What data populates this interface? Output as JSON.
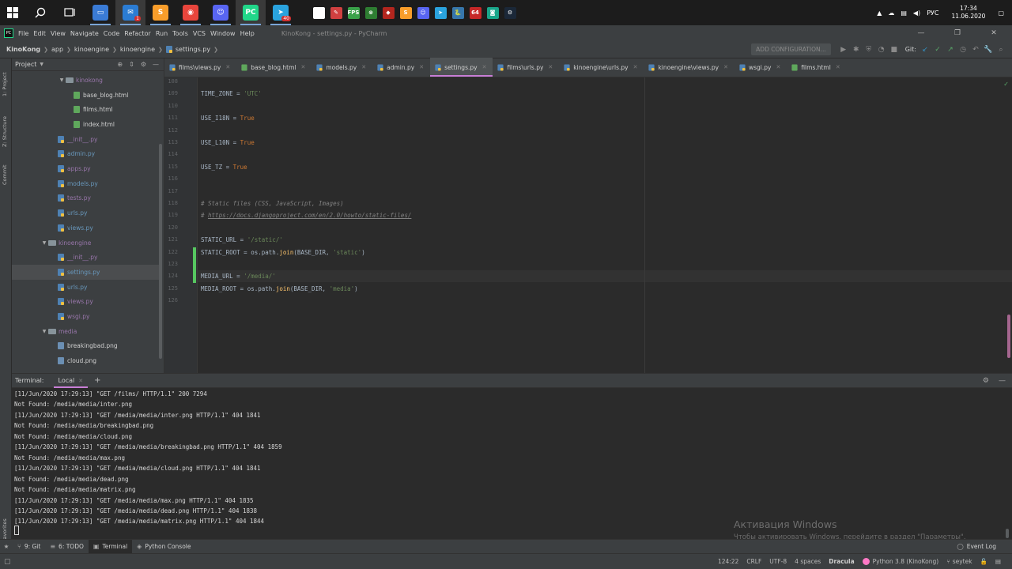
{
  "taskbar": {
    "apps": [
      {
        "name": "file-explorer",
        "color": "#3a7bd5",
        "glyph": "▭"
      },
      {
        "name": "mail",
        "color": "#2b7cd3",
        "glyph": "✉",
        "badge": "1",
        "active": true
      },
      {
        "name": "sublime-text",
        "color": "#f89d2a",
        "glyph": "S"
      },
      {
        "name": "chrome",
        "color": "#e8453c",
        "glyph": "◉"
      },
      {
        "name": "discord",
        "color": "#5865f2",
        "glyph": "☺"
      },
      {
        "name": "pycharm",
        "color": "#21d789",
        "glyph": "PC",
        "active": true
      },
      {
        "name": "telegram",
        "color": "#2aa3de",
        "glyph": "➤",
        "badge": "40"
      }
    ],
    "tray_apps": [
      {
        "name": "notepad",
        "color": "#ffffff",
        "glyph": ""
      },
      {
        "name": "pen-tool",
        "color": "#d04040",
        "glyph": "✎"
      },
      {
        "name": "fps-monitor",
        "color": "#3aa24a",
        "glyph": "FPS"
      },
      {
        "name": "xbox",
        "color": "#2e7d32",
        "glyph": "⊗"
      },
      {
        "name": "dota",
        "color": "#b3261e",
        "glyph": "◆"
      },
      {
        "name": "sublime-tray",
        "color": "#f89d2a",
        "glyph": "S"
      },
      {
        "name": "discord-tray",
        "color": "#5865f2",
        "glyph": "☺"
      },
      {
        "name": "telegram-tray",
        "color": "#2aa3de",
        "glyph": "➤"
      },
      {
        "name": "python-tray",
        "color": "#3776ab",
        "glyph": "🐍"
      },
      {
        "name": "aida64",
        "color": "#c62828",
        "glyph": "64"
      },
      {
        "name": "gamepad",
        "color": "#1aa68a",
        "glyph": "◙"
      },
      {
        "name": "steam",
        "color": "#1b2838",
        "glyph": "⚙"
      }
    ],
    "lang": "РУС",
    "time": "17:34",
    "date": "11.06.2020"
  },
  "menu": {
    "items": [
      "File",
      "Edit",
      "View",
      "Navigate",
      "Code",
      "Refactor",
      "Run",
      "Tools",
      "VCS",
      "Window",
      "Help"
    ],
    "title": "KinoKong - settings.py - PyCharm"
  },
  "breadcrumbs": [
    "KinoKong",
    "app",
    "kinoengine",
    "kinoengine",
    "settings.py"
  ],
  "nav": {
    "add_config": "ADD CONFIGURATION...",
    "git_label": "Git:"
  },
  "side_tabs": {
    "project": "1: Project",
    "structure": "Z: Structure",
    "commit": "Commit",
    "favorites": "2: Favorites"
  },
  "project_panel": {
    "title": "Project",
    "tree": [
      {
        "label": "kinokong",
        "type": "folder",
        "indent": 1,
        "open": true
      },
      {
        "label": "base_blog.html",
        "type": "html",
        "indent": 2
      },
      {
        "label": "films.html",
        "type": "html",
        "indent": 2
      },
      {
        "label": "index.html",
        "type": "html",
        "indent": 2
      },
      {
        "label": "__init__.py",
        "type": "py-dim",
        "indent": 0
      },
      {
        "label": "admin.py",
        "type": "py",
        "indent": 0
      },
      {
        "label": "apps.py",
        "type": "py-dim",
        "indent": 0
      },
      {
        "label": "models.py",
        "type": "py",
        "indent": 0
      },
      {
        "label": "tests.py",
        "type": "py-dim",
        "indent": 0
      },
      {
        "label": "urls.py",
        "type": "py",
        "indent": 0
      },
      {
        "label": "views.py",
        "type": "py",
        "indent": 0
      },
      {
        "label": "kinoengine",
        "type": "folder",
        "indent": -1,
        "open": true
      },
      {
        "label": "__init__.py",
        "type": "py-dim",
        "indent": 0
      },
      {
        "label": "settings.py",
        "type": "py",
        "indent": 0,
        "selected": true
      },
      {
        "label": "urls.py",
        "type": "py",
        "indent": 0
      },
      {
        "label": "views.py",
        "type": "py-dim",
        "indent": 0
      },
      {
        "label": "wsgi.py",
        "type": "py-dim",
        "indent": 0
      },
      {
        "label": "media",
        "type": "folder",
        "indent": -1,
        "open": true
      },
      {
        "label": "breakingbad.png",
        "type": "png",
        "indent": 0
      },
      {
        "label": "cloud.png",
        "type": "png",
        "indent": 0
      }
    ]
  },
  "editor": {
    "tabs": [
      {
        "label": "films\\views.py",
        "type": "py"
      },
      {
        "label": "base_blog.html",
        "type": "html"
      },
      {
        "label": "models.py",
        "type": "py"
      },
      {
        "label": "admin.py",
        "type": "py"
      },
      {
        "label": "settings.py",
        "type": "py",
        "active": true
      },
      {
        "label": "films\\urls.py",
        "type": "py"
      },
      {
        "label": "kinoengine\\urls.py",
        "type": "py"
      },
      {
        "label": "kinoengine\\views.py",
        "type": "py"
      },
      {
        "label": "wsgi.py",
        "type": "py"
      },
      {
        "label": "films.html",
        "type": "html"
      }
    ],
    "lines": [
      {
        "n": "108",
        "code": []
      },
      {
        "n": "109",
        "code": [
          [
            "plain",
            "TIME_ZONE = "
          ],
          [
            "str",
            "'UTC'"
          ]
        ]
      },
      {
        "n": "110",
        "code": []
      },
      {
        "n": "111",
        "code": [
          [
            "plain",
            "USE_I18N = "
          ],
          [
            "kw",
            "True"
          ]
        ]
      },
      {
        "n": "112",
        "code": []
      },
      {
        "n": "113",
        "code": [
          [
            "plain",
            "USE_L10N = "
          ],
          [
            "kw",
            "True"
          ]
        ]
      },
      {
        "n": "114",
        "code": []
      },
      {
        "n": "115",
        "code": [
          [
            "plain",
            "USE_TZ = "
          ],
          [
            "kw",
            "True"
          ]
        ]
      },
      {
        "n": "116",
        "code": []
      },
      {
        "n": "117",
        "code": []
      },
      {
        "n": "118",
        "code": [
          [
            "cm",
            "# Static files (CSS, JavaScript, Images)"
          ]
        ]
      },
      {
        "n": "119",
        "code": [
          [
            "cm",
            "# "
          ],
          [
            "link",
            "https://docs.djangoproject.com/en/2.0/howto/static-files/"
          ]
        ]
      },
      {
        "n": "120",
        "code": []
      },
      {
        "n": "121",
        "code": [
          [
            "plain",
            "STATIC_URL = "
          ],
          [
            "str",
            "'/static/'"
          ]
        ]
      },
      {
        "n": "122",
        "code": [
          [
            "plain",
            "STATIC_ROOT = os.path."
          ],
          [
            "fn",
            "join"
          ],
          [
            "plain",
            "(BASE_DIR, "
          ],
          [
            "str",
            "'static'"
          ],
          [
            "plain",
            ")"
          ]
        ],
        "changed": true
      },
      {
        "n": "123",
        "code": [],
        "changed": true
      },
      {
        "n": "124",
        "code": [
          [
            "plain",
            "MEDIA_URL = "
          ],
          [
            "str",
            "'/media/'"
          ]
        ],
        "changed": true,
        "current": true
      },
      {
        "n": "125",
        "code": [
          [
            "plain",
            "MEDIA_ROOT = os.path."
          ],
          [
            "fn",
            "join"
          ],
          [
            "plain",
            "(BASE_DIR, "
          ],
          [
            "str",
            "'media'"
          ],
          [
            "plain",
            ")"
          ]
        ]
      },
      {
        "n": "126",
        "code": []
      }
    ]
  },
  "terminal": {
    "title": "Terminal:",
    "tab": "Local",
    "lines": [
      "[11/Jun/2020 17:29:13] \"GET /films/ HTTP/1.1\" 200 7294",
      "Not Found: /media/media/inter.png",
      "[11/Jun/2020 17:29:13] \"GET /media/media/inter.png HTTP/1.1\" 404 1841",
      "Not Found: /media/media/breakingbad.png",
      "Not Found: /media/media/cloud.png",
      "[11/Jun/2020 17:29:13] \"GET /media/media/breakingbad.png HTTP/1.1\" 404 1859",
      "Not Found: /media/media/max.png",
      "[11/Jun/2020 17:29:13] \"GET /media/media/cloud.png HTTP/1.1\" 404 1841",
      "Not Found: /media/media/dead.png",
      "Not Found: /media/media/matrix.png",
      "[11/Jun/2020 17:29:13] \"GET /media/media/max.png HTTP/1.1\" 404 1835",
      "[11/Jun/2020 17:29:13] \"GET /media/media/dead.png HTTP/1.1\" 404 1838",
      "[11/Jun/2020 17:29:13] \"GET /media/media/matrix.png HTTP/1.1\" 404 1844"
    ]
  },
  "watermark": {
    "line1": "Активация Windows",
    "line2": "Чтобы активировать Windows, перейдите в раздел \"Параметры\"."
  },
  "bottom_tools": [
    {
      "label": "9: Git",
      "icon": "⑂"
    },
    {
      "label": "6: TODO",
      "icon": "≡"
    },
    {
      "label": "Terminal",
      "icon": "▣",
      "active": true
    },
    {
      "label": "Python Console",
      "icon": "◈"
    }
  ],
  "event_log": "Event Log",
  "status": {
    "position": "124:22",
    "line_sep": "CRLF",
    "encoding": "UTF-8",
    "indent": "4 spaces",
    "theme": "Dracula",
    "interpreter": "Python 3.8 (KinoKong)",
    "branch": "seytek"
  }
}
